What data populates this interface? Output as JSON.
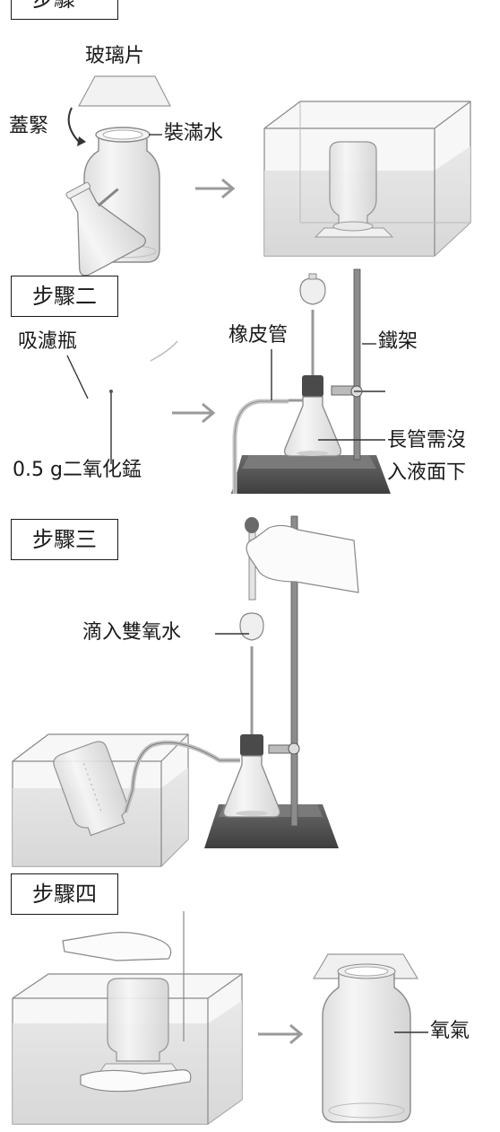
{
  "steps": {
    "step1": {
      "title": "步驟一",
      "glass_plate": "玻璃片",
      "cover_tight": "蓋緊",
      "fill_water": "裝滿水"
    },
    "step2": {
      "title": "步驟二",
      "filter_flask": "吸濾瓶",
      "rubber_tube": "橡皮管",
      "iron_stand": "鐵架",
      "long_tube_note_1": "長管需沒",
      "long_tube_note_2": "入液面下",
      "manganese_dioxide": "0.5 g二氧化錳"
    },
    "step3": {
      "title": "步驟三",
      "drip_peroxide": "滴入雙氧水"
    },
    "step4": {
      "title": "步驟四",
      "oxygen": "氧氣"
    }
  },
  "colors": {
    "stroke": "#555555",
    "outline": "#1a1a1a",
    "glass": "#ececec",
    "water": "#dcdcdc",
    "stand": "#5a5a5a",
    "arrow": "#9a9a9a"
  }
}
